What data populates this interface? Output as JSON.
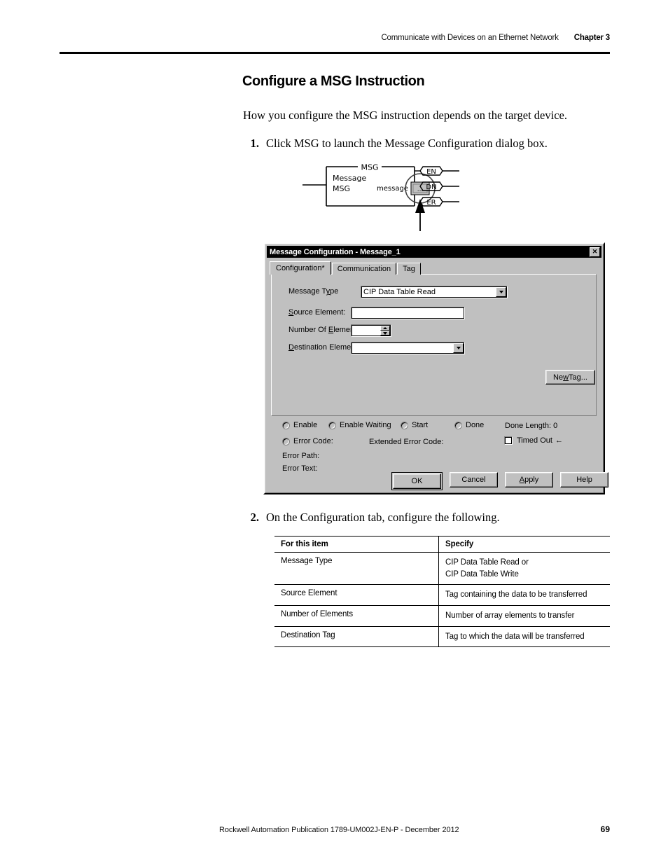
{
  "header": {
    "running_title": "Communicate with Devices on an Ethernet Network",
    "chapter": "Chapter 3"
  },
  "section": {
    "title": "Configure a MSG Instruction",
    "intro": "How you configure the MSG instruction depends on the target device."
  },
  "steps": [
    {
      "num": "1.",
      "text": "Click MSG to launch the Message Configuration dialog box."
    },
    {
      "num": "2.",
      "text": "On the Configuration tab, configure the following."
    }
  ],
  "rung": {
    "block_title": "MSG",
    "line1": "Message",
    "line2": "MSG",
    "operand_label": "message",
    "browse_button": "...",
    "outputs": [
      "EN",
      "DN",
      "ER"
    ]
  },
  "dialog": {
    "title": "Message Configuration - Message_1",
    "close_glyph": "✕",
    "tabs": [
      {
        "label": "Configuration*",
        "active": true
      },
      {
        "label": "Communication",
        "active": false
      },
      {
        "label": "Tag",
        "active": false
      }
    ],
    "fields": {
      "message_type_label": "Message Type",
      "message_type_label_pre": "Message T",
      "message_type_label_acc": "y",
      "message_type_label_post": "pe",
      "message_type_value": "CIP Data Table Read",
      "source_element_label_acc": "S",
      "source_element_label_post": "ource Element:",
      "source_element_value": "",
      "number_of_elements_pre": "Number Of ",
      "number_of_elements_acc": "E",
      "number_of_elements_post": "lements:",
      "number_of_elements_value": "",
      "destination_element_acc": "D",
      "destination_element_post": "estination Element:",
      "destination_element_value": ""
    },
    "new_tag_pre": "Ne",
    "new_tag_acc": "w",
    "new_tag_post": " Tag...",
    "status": {
      "enable": "Enable",
      "enable_waiting": "Enable Waiting",
      "start": "Start",
      "done": "Done",
      "done_length": "Done Length:  0",
      "error_code": "Error Code:",
      "extended_error_code": "Extended Error Code:",
      "timed_out": "Timed Out",
      "timed_out_arrow": "←",
      "error_path": "Error Path:",
      "error_text": "Error Text:"
    },
    "buttons": {
      "ok": "OK",
      "cancel": "Cancel",
      "apply_pre": "",
      "apply_acc": "A",
      "apply_post": "pply",
      "help": "Help"
    }
  },
  "table": {
    "headers": [
      "For this item",
      "Specify"
    ],
    "rows": [
      {
        "item": "Message Type",
        "specify_lines": [
          "CIP Data Table Read or",
          "CIP Data Table Write"
        ]
      },
      {
        "item": "Source Element",
        "specify_lines": [
          "Tag containing the data to be transferred"
        ]
      },
      {
        "item": "Number of Elements",
        "specify_lines": [
          "Number of array elements to transfer"
        ]
      },
      {
        "item": "Destination Tag",
        "specify_lines": [
          "Tag to which the data will be transferred"
        ]
      }
    ]
  },
  "footer": {
    "publication": "Rockwell Automation Publication 1789-UM002J-EN-P - December 2012",
    "page_number": "69"
  },
  "colors": {
    "dialog_face": "#c0c0c0",
    "titlebar": "#000000",
    "titlebar_text": "#ffffff",
    "field_bg": "#ffffff",
    "rule": "#000000"
  }
}
